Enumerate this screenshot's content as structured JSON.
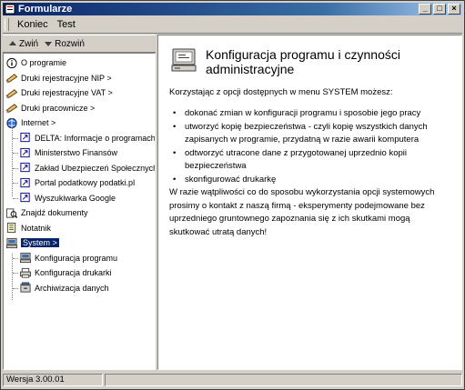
{
  "window": {
    "title": "Formularze"
  },
  "menubar": {
    "items": [
      {
        "label": "Koniec"
      },
      {
        "label": "Test"
      }
    ]
  },
  "nav_toolbar": {
    "collapse_label": "Zwiń",
    "expand_label": "Rozwiń"
  },
  "tree": {
    "items": [
      {
        "label": "O programie",
        "icon": "info-icon",
        "level": 0
      },
      {
        "label": "Druki rejestracyjne NIP >",
        "icon": "form-icon",
        "level": 0
      },
      {
        "label": "Druki rejestracyjne VAT >",
        "icon": "form-icon",
        "level": 0
      },
      {
        "label": "Druki pracownicze >",
        "icon": "form-icon",
        "level": 0
      },
      {
        "label": "Internet >",
        "icon": "globe-icon",
        "level": 0
      },
      {
        "label": "DELTA: Informacje o programach",
        "icon": "link-icon",
        "level": 1
      },
      {
        "label": "Ministerstwo Finansów",
        "icon": "link-icon",
        "level": 1
      },
      {
        "label": "Zakład Ubezpieczeń Społecznych",
        "icon": "link-icon",
        "level": 1
      },
      {
        "label": "Portal podatkowy podatki.pl",
        "icon": "link-icon",
        "level": 1
      },
      {
        "label": "Wyszukiwarka Google",
        "icon": "link-icon",
        "level": 1
      },
      {
        "label": "Znajdź dokumenty",
        "icon": "find-icon",
        "level": 0
      },
      {
        "label": "Notatnik",
        "icon": "notepad-icon",
        "level": 0
      },
      {
        "label": "System >",
        "icon": "computer-icon",
        "level": 0,
        "selected": true
      },
      {
        "label": "Konfiguracja programu",
        "icon": "computer-icon",
        "level": 1
      },
      {
        "label": "Konfiguracja drukarki",
        "icon": "printer-icon",
        "level": 1
      },
      {
        "label": "Archiwizacja danych",
        "icon": "archive-icon",
        "level": 1
      }
    ]
  },
  "content": {
    "title": "Konfiguracja programu i czynności administracyjne",
    "intro": "Korzystając z opcji dostępnych w menu SYSTEM możesz:",
    "bullets": [
      "dokonać zmian w konfiguracji programu i sposobie jego pracy",
      "utworzyć kopię bezpieczeństwa - czyli kopię wszystkich danych zapisanych w programie, przydatną w razie awarii komputera",
      "odtworzyć utracone dane z przygotowanej uprzednio kopii bezpieczeństwa",
      "skonfigurować drukarkę"
    ],
    "warning": "W razie wątpliwości co do sposobu wykorzystania opcji systemowych prosimy o kontakt z naszą firmą - eksperymenty podejmowane bez uprzedniego gruntownego zapoznania się z ich skutkami mogą skutkować utratą danych!"
  },
  "statusbar": {
    "version": "Wersja 3.00.01"
  },
  "colors": {
    "titlebar": "#0a246a",
    "face": "#d4d0c8",
    "selection": "#0a246a"
  }
}
